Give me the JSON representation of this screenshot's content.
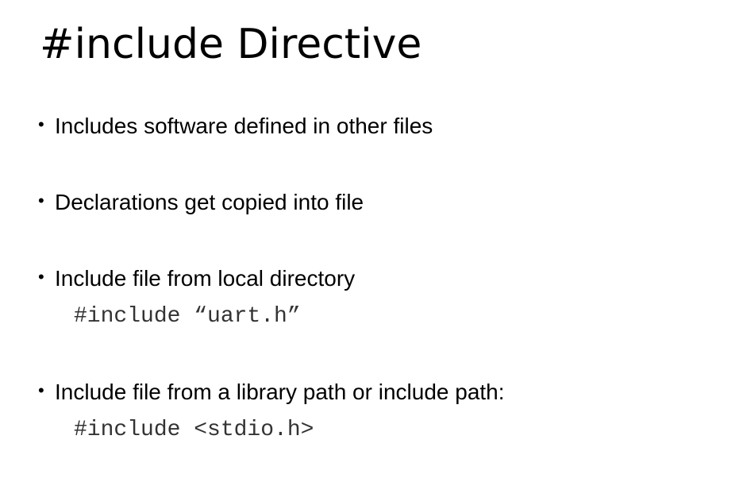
{
  "slide": {
    "title": "#include Directive",
    "bullet_symbol": "•",
    "bullets": [
      {
        "text": "Includes software defined in other files"
      },
      {
        "text": "Declarations get copied into file"
      },
      {
        "text": "Include file from local directory",
        "code": "#include “uart.h”"
      },
      {
        "text": "Include file from a library path or include path:",
        "code": "#include <stdio.h>"
      }
    ]
  }
}
